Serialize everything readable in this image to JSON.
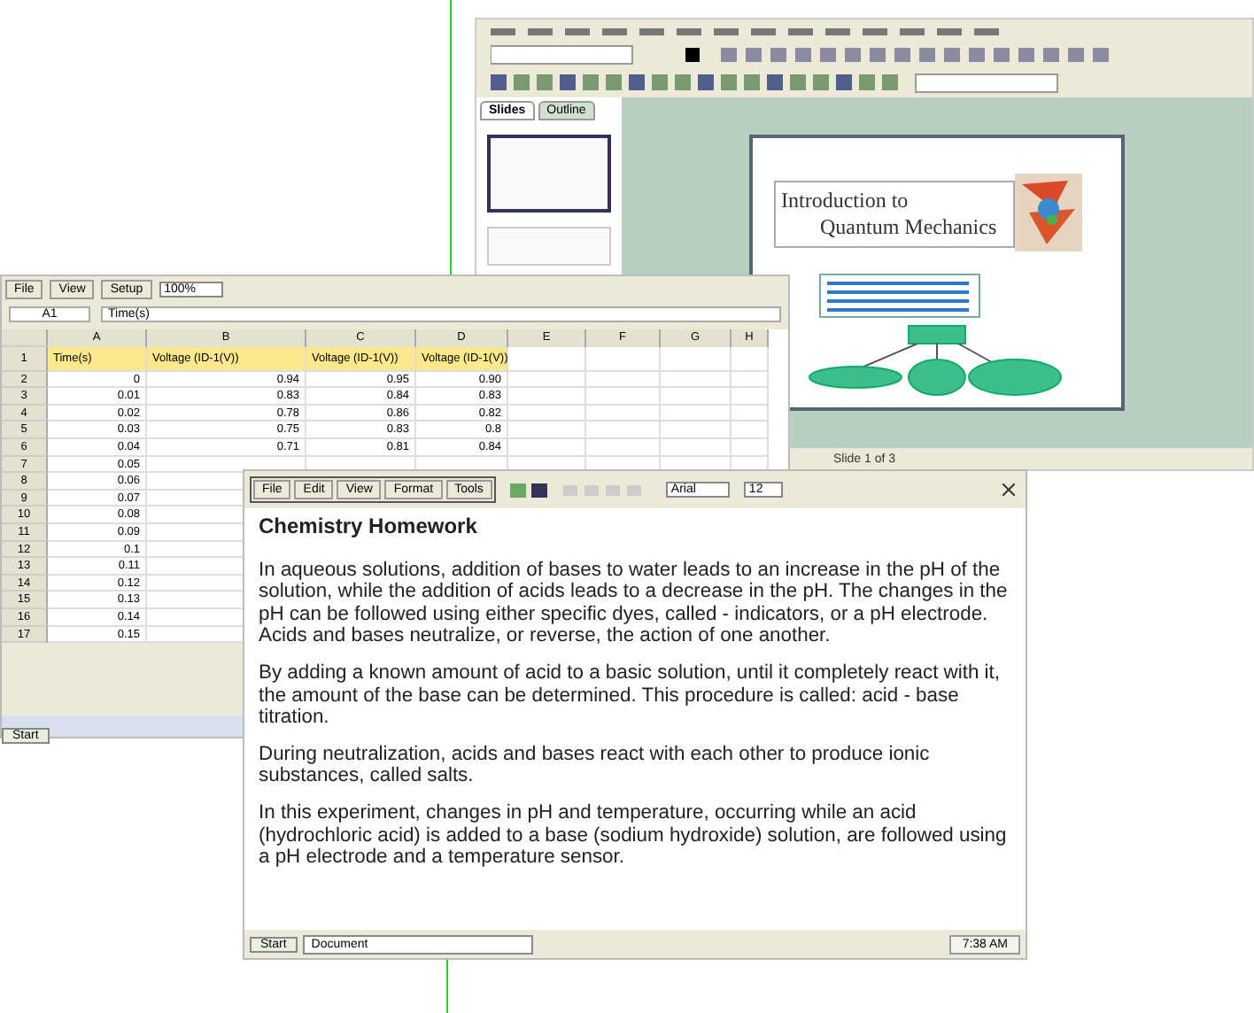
{
  "presentation_window": {
    "panel_tabs": [
      {
        "label": "Slides",
        "selected": true
      },
      {
        "label": "Outline",
        "selected": false
      }
    ],
    "slide": {
      "title_lines": [
        "Introduction to",
        "Quantum Mechanics"
      ]
    },
    "status_bar": {
      "slide_position": "Slide 1 of 3"
    }
  },
  "spreadsheet_window": {
    "menu": [
      "File",
      "View",
      "Setup"
    ],
    "zoom": "100%",
    "cell_reference": "A1",
    "formula": "Time(s)",
    "columns": [
      "A",
      "B",
      "C",
      "D",
      "E",
      "F",
      "G",
      "H"
    ],
    "rows": [
      {
        "number": "1",
        "highlighted": true,
        "cells": [
          "Time(s)",
          "Voltage (ID-1(V))",
          "Voltage (ID-1(V))",
          "Voltage (ID-1(V))"
        ]
      },
      {
        "number": "2",
        "highlighted": false,
        "cells": [
          "0",
          "0.94",
          "0.95",
          "0.90"
        ]
      },
      {
        "number": "3",
        "highlighted": false,
        "cells": [
          "0.01",
          "0.83",
          "0.84",
          "0.83"
        ]
      },
      {
        "number": "4",
        "highlighted": false,
        "cells": [
          "0.02",
          "0.78",
          "0.86",
          "0.82"
        ]
      },
      {
        "number": "5",
        "highlighted": false,
        "cells": [
          "0.03",
          "0.75",
          "0.83",
          "0.8"
        ]
      },
      {
        "number": "6",
        "highlighted": false,
        "cells": [
          "0.04",
          "0.71",
          "0.81",
          "0.84"
        ]
      },
      {
        "number": "7",
        "highlighted": false,
        "cells": [
          "0.05"
        ]
      },
      {
        "number": "8",
        "highlighted": false,
        "cells": [
          "0.06"
        ]
      },
      {
        "number": "9",
        "highlighted": false,
        "cells": [
          "0.07"
        ]
      },
      {
        "number": "10",
        "highlighted": false,
        "cells": [
          "0.08"
        ]
      },
      {
        "number": "11",
        "highlighted": false,
        "cells": [
          "0.09"
        ]
      },
      {
        "number": "12",
        "highlighted": false,
        "cells": [
          "0.1"
        ]
      },
      {
        "number": "13",
        "highlighted": false,
        "cells": [
          "0.11"
        ]
      },
      {
        "number": "14",
        "highlighted": false,
        "cells": [
          "0.12"
        ]
      },
      {
        "number": "15",
        "highlighted": false,
        "cells": [
          "0.13"
        ]
      },
      {
        "number": "16",
        "highlighted": false,
        "cells": [
          "0.14"
        ]
      },
      {
        "number": "17",
        "highlighted": false,
        "cells": [
          "0.15"
        ]
      }
    ],
    "taskbar": {
      "start": "Start"
    }
  },
  "document_window": {
    "menu": [
      "File",
      "Edit",
      "View",
      "Format",
      "Tools"
    ],
    "font": "Arial",
    "font_size": "12",
    "heading": "Chemistry Homework",
    "paragraphs": [
      "In aqueous solutions, addition of bases to water leads to an increase in the pH of the solution, while the addition of acids leads to a decrease in the pH. The changes in the pH can be followed using either specific dyes, called - indicators, or a pH electrode. Acids and bases neutralize, or reverse, the action of one another.",
      "By adding a known amount of acid to a basic solution, until it completely react with it, the amount of the base can be determined. This procedure is called: acid - base titration.",
      "During neutralization, acids and bases react with each other to produce ionic substances, called salts.",
      "In this experiment, changes in pH and temperature, occurring while an acid (hydrochloric acid) is added to a base (sodium hydroxide) solution, are followed using a pH electrode and a temperature sensor."
    ],
    "taskbar": {
      "start": "Start",
      "task": "Document",
      "clock": "7:38 AM"
    }
  }
}
